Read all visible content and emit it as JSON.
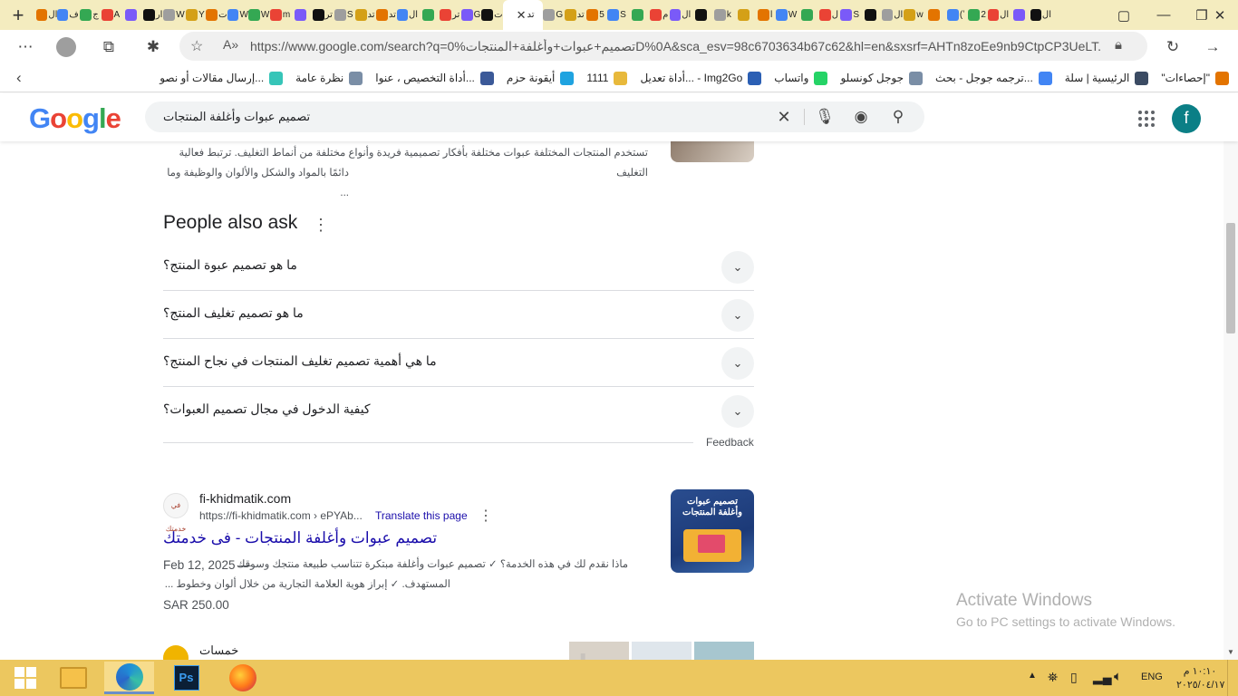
{
  "browser": {
    "tab_glyphs": [
      "ال",
      "ف",
      "ج",
      "A",
      "",
      "ار",
      "W",
      "Y",
      "ت",
      "W",
      "W",
      "m",
      "",
      "تر",
      "S",
      "تد",
      "تد",
      "ال",
      "",
      "تر",
      "G",
      "ت",
      "G",
      "تد",
      "5",
      "S",
      "",
      "م",
      "ال",
      "",
      "k",
      "",
      "ا",
      "W",
      "",
      "ل",
      "S",
      "",
      "ال",
      "w",
      "",
      "(ʼ",
      "2",
      "ال",
      "",
      "ال"
    ],
    "active_tab": "تد",
    "url": "https://www.google.com/search?q=0%تصميم+عبوات+وأغلفة+المنتجاتD%0A&sca_esv=98c6703634b67c62&hl=en&sxsrf=AHTn8zoEe9nb9CtpCP3UeLT...",
    "favorites": [
      {
        "label": "\"إحصاءات\"",
        "color": "#e37400"
      },
      {
        "label": "الرئيسية | سلة",
        "color": "#3b4b63"
      },
      {
        "label": "ترجمه جوجل - بحث...",
        "color": "#4285f4"
      },
      {
        "label": "جوجل كونسلو",
        "color": "#7a8ea6"
      },
      {
        "label": "واتساب",
        "color": "#25d366"
      },
      {
        "label": "أداة تعديل... - Img2Go",
        "color": "#2b5fb4"
      },
      {
        "label": "1111",
        "color": "#e8b93b"
      },
      {
        "label": "أيقونة حزم",
        "color": "#1fa3e0"
      },
      {
        "label": "أداة التخصيص ، عنوا...",
        "color": "#3b5998"
      },
      {
        "label": "نظرة عامة",
        "color": "#7a8ea6"
      },
      {
        "label": "إرسال مقالات أو نصو...",
        "color": "#36c5b8"
      }
    ]
  },
  "google": {
    "logo": "Google",
    "query": "تصميم عبوات وأغلفة المنتجات",
    "avatar_letter": "f"
  },
  "top_snippet": {
    "line1": "تستخدم المنتجات المختلفة عبوات مختلفة بأفكار تصميمية فريدة وأنواع مختلفة من أنماط التغليف. ترتبط فعالية التغليف",
    "line2": "دائمًا بالمواد والشكل والألوان والوظيفة وما ..."
  },
  "paa": {
    "title": "People also ask",
    "questions": [
      "ما هو تصميم عبوة المنتج؟",
      "ما هو تصميم تغليف المنتج؟",
      "ما هي أهمية تصميم تغليف المنتجات في نجاح المنتج؟",
      "كيفية الدخول في مجال تصميم العبوات؟"
    ],
    "feedback": "Feedback"
  },
  "result": {
    "site": "fi-khidmatik.com",
    "cite": "https://fi-khidmatik.com › ePYAb...",
    "translate": "Translate this page",
    "title": "تصميم عبوات وأغلفة المنتجات - فى خدمتك",
    "date": "Feb 12, 2025 —",
    "snippet1": "ماذا نقدم لك في هذه الخدمة؟ ✓ تصميم عبوات وأغلفة مبتكرة تتناسب طبيعة منتجك وسوقك",
    "snippet2": "المستهدف. ✓ إبراز هوية العلامة التجارية من خلال ألوان وخطوط ...",
    "price": "SAR 250.00",
    "thumb_text": "تصميم عبوات وأغلفة المنتجات",
    "favicon_text": "في خدمتك"
  },
  "next_result": {
    "site": "خمسات",
    "watermark": "خمسات"
  },
  "activate": {
    "line1": "Activate Windows",
    "line2": "Go to PC settings to activate Windows."
  },
  "taskbar": {
    "language": "ENG",
    "time": "١٠:١٠ م",
    "date": "٢٠٢٥/٠٤/١٧"
  }
}
